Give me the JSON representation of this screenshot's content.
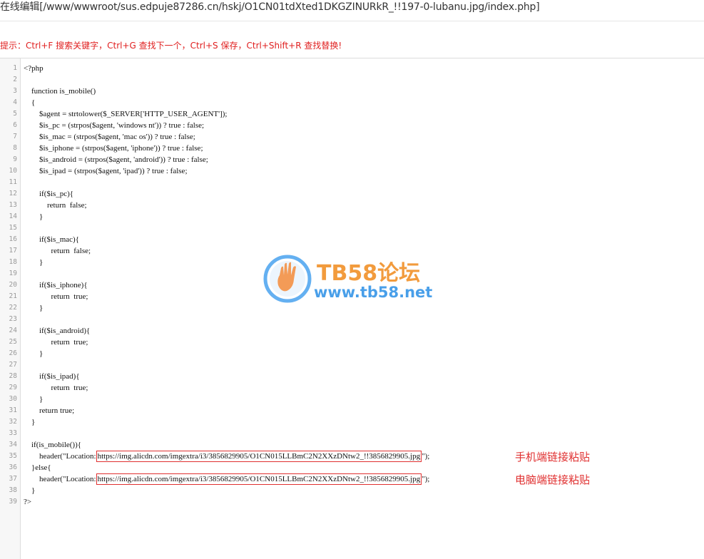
{
  "titlebar": {
    "text": "在线编辑[/www/wwwroot/sus.edpuje87286.cn/hskj/O1CN01tdXted1DKGZINURkR_!!197-0-lubanu.jpg/index.php]"
  },
  "hint": {
    "text": "提示：Ctrl+F 搜索关键字，Ctrl+G 查找下一个，Ctrl+S 保存，Ctrl+Shift+R 查找替换!"
  },
  "code_lines": [
    "<?php",
    "",
    "    function is_mobile()",
    "    {",
    "        $agent = strtolower($_SERVER['HTTP_USER_AGENT']);",
    "        $is_pc = (strpos($agent, 'windows nt')) ? true : false;",
    "        $is_mac = (strpos($agent, 'mac os')) ? true : false;",
    "        $is_iphone = (strpos($agent, 'iphone')) ? true : false;",
    "        $is_android = (strpos($agent, 'android')) ? true : false;",
    "        $is_ipad = (strpos($agent, 'ipad')) ? true : false;",
    "",
    "        if($is_pc){",
    "            return  false;",
    "        }",
    "",
    "        if($is_mac){",
    "              return  false;",
    "        }",
    "",
    "        if($is_iphone){",
    "              return  true;",
    "        }",
    "",
    "        if($is_android){",
    "              return  true;",
    "        }",
    "",
    "        if($is_ipad){",
    "              return  true;",
    "        }",
    "        return true;",
    "    }",
    "",
    "    if(is_mobile()){",
    "",
    "    }else{",
    "",
    "    }",
    "?>"
  ],
  "line35": {
    "prefix": "        header(\"Location:",
    "url": "https://img.alicdn.com/imgextra/i3/3856829905/O1CN015LLBmC2N2XXzDNtw2_!!3856829905.jpg",
    "suffix": "\");"
  },
  "line37": {
    "prefix": "        header(\"Location:",
    "url": "https://img.alicdn.com/imgextra/i3/3856829905/O1CN015LLBmC2N2XXzDNtw2_!!3856829905.jpg",
    "suffix": "\");"
  },
  "annotations": {
    "mobile": "手机端链接粘贴",
    "pc": "电脑端链接粘贴"
  },
  "watermark": {
    "title": "TB58论坛",
    "url": "www.tb58.net",
    "colors": {
      "title": "#f08a1c",
      "url": "#2a8fe6"
    }
  },
  "colors": {
    "hint": "#e02020",
    "annotation": "#e03030",
    "gutter": "#f7f7f7"
  }
}
